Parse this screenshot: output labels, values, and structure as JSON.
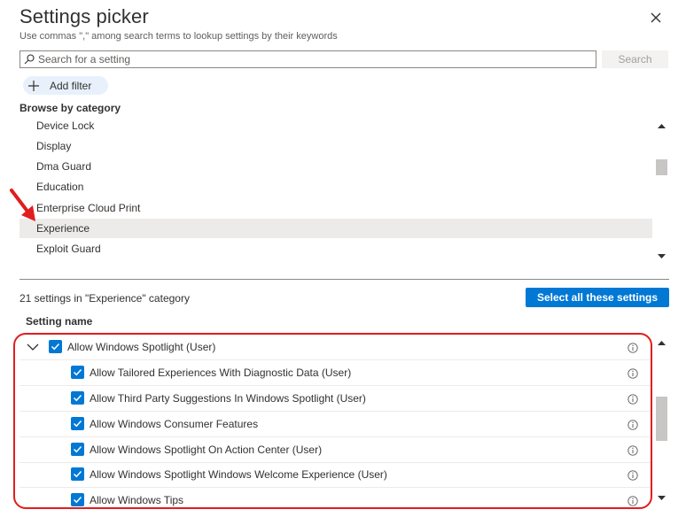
{
  "header": {
    "title": "Settings picker",
    "subtitle": "Use commas \",\" among search terms to lookup settings by their keywords"
  },
  "search": {
    "placeholder": "Search for a setting",
    "value": "",
    "button_label": "Search"
  },
  "filter": {
    "add_label": "Add filter"
  },
  "browse": {
    "label": "Browse by category",
    "categories": [
      "Device Lock",
      "Display",
      "Dma Guard",
      "Education",
      "Enterprise Cloud Print",
      "Experience",
      "Exploit Guard"
    ],
    "selected": "Experience"
  },
  "results": {
    "count_label": "21 settings in \"Experience\" category",
    "select_all_label": "Select all these settings",
    "column_header": "Setting name",
    "parent": {
      "label": "Allow Windows Spotlight (User)",
      "checked": true,
      "expanded": true
    },
    "children": [
      {
        "label": "Allow Tailored Experiences With Diagnostic Data (User)",
        "checked": true
      },
      {
        "label": "Allow Third Party Suggestions In Windows Spotlight (User)",
        "checked": true
      },
      {
        "label": "Allow Windows Consumer Features",
        "checked": true
      },
      {
        "label": "Allow Windows Spotlight On Action Center (User)",
        "checked": true
      },
      {
        "label": "Allow Windows Spotlight Windows Welcome Experience (User)",
        "checked": true
      },
      {
        "label": "Allow Windows Tips",
        "checked": true
      }
    ]
  },
  "colors": {
    "accent": "#0078d4",
    "annotation": "#e01e1e",
    "selected_bg": "#edebe9"
  },
  "icons": {
    "close": "close-icon",
    "search": "search-icon",
    "add": "plus-icon",
    "info": "info-icon",
    "chevron": "chevron-down-icon"
  }
}
